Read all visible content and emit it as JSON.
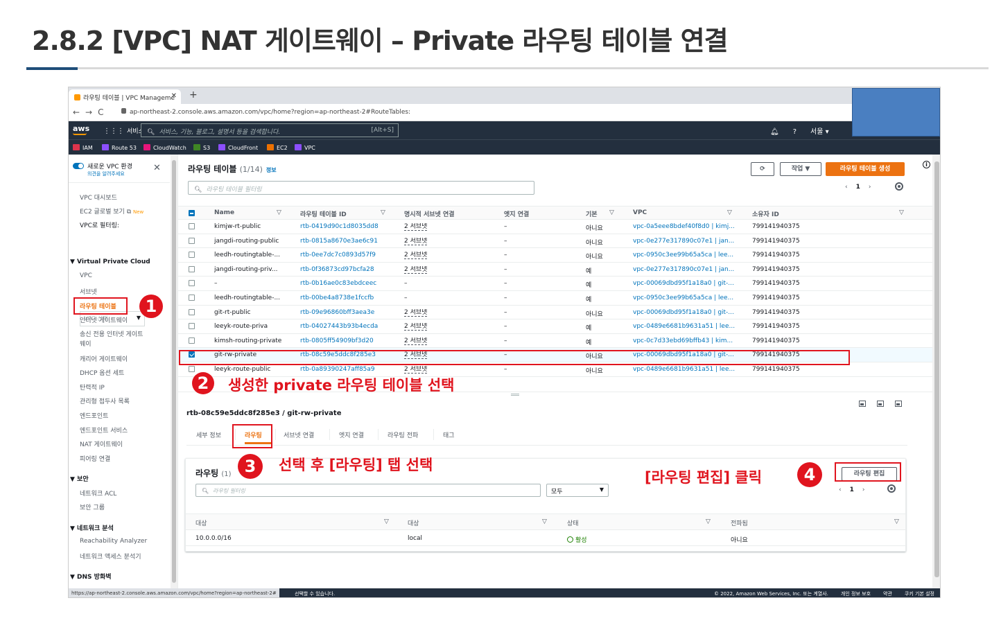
{
  "slide": {
    "title": "2.8.2 [VPC] NAT 게이트웨이 – Private 라우팅 테이블 연결"
  },
  "browser": {
    "tab_title": "라우팅 테이블 | VPC Manageme",
    "new_tab": "+",
    "url": "ap-northeast-2.console.aws.amazon.com/vpc/home?region=ap-northeast-2#RouteTables:"
  },
  "aws_nav": {
    "logo": "aws",
    "services": "서비스",
    "search_placeholder": "서비스, 기능, 블로그, 설명서 등을 검색합니다.",
    "search_hotkey": "[Alt+S]",
    "region": "서울 ▾",
    "bookmarks": [
      "IAM",
      "Route 53",
      "CloudWatch",
      "S3",
      "CloudFront",
      "EC2",
      "VPC"
    ]
  },
  "sidebar": {
    "new_vpc": "새로운 VPC 환경",
    "feedback": "의견을 알려주세요",
    "dashboard": "VPC 대시보드",
    "ec2_global": "EC2 글로벌 보기",
    "new_badge": "New",
    "filter_label": "VPC로 필터링:",
    "filter_placeholder": "VPC 선택",
    "section_vpc": "▼ Virtual Private Cloud",
    "items": [
      "VPC",
      "서브넷",
      "라우팅 테이블",
      "인터넷 게이트웨이",
      "송신 전용 인터넷 게이트",
      "웨이",
      "캐리어 게이트웨이",
      "DHCP 옵션 세트",
      "탄력적 IP",
      "관리형 접두사 목록",
      "엔드포인트",
      "엔드포인트 서비스",
      "NAT 게이트웨이",
      "피어링 연결"
    ],
    "section_security": "▼ 보안",
    "security_items": [
      "네트워크 ACL",
      "보안 그룹"
    ],
    "section_netanalysis": "▼ 네트워크 분석",
    "netanalysis_items": [
      "Reachability Analyzer",
      "네트워크 액세스 분석기"
    ],
    "section_dns": "▼ DNS 방화벽"
  },
  "main": {
    "title": "라우팅 테이블",
    "count": "(1/14)",
    "info": "정보",
    "actions": "작업 ▼",
    "create": "라우팅 테이블 생성",
    "filter_placeholder": "라우팅 테이블 필터링",
    "page": "1",
    "columns": [
      "Name",
      "라우팅 테이블 ID",
      "명시적 서브넷 연결",
      "엣지 연결",
      "기본",
      "VPC",
      "소유자 ID"
    ],
    "rows": [
      {
        "name": "kimjw-rt-public",
        "id": "rtb-0419d90c1d8035dd8",
        "subnet": "2 서브넷",
        "edge": "–",
        "main": "아니요",
        "vpc": "vpc-0a5eee8bdef40f8d0 | kimj...",
        "owner": "799141940375"
      },
      {
        "name": "jangdi-routing-public",
        "id": "rtb-0815a8670e3ae6c91",
        "subnet": "2 서브넷",
        "edge": "–",
        "main": "아니요",
        "vpc": "vpc-0e277e317890c07e1 | jan...",
        "owner": "799141940375"
      },
      {
        "name": "leedh-routingtable-...",
        "id": "rtb-0ee7dc7c0893d57f9",
        "subnet": "2 서브넷",
        "edge": "–",
        "main": "아니요",
        "vpc": "vpc-0950c3ee99b65a5ca | lee...",
        "owner": "799141940375"
      },
      {
        "name": "jangdi-routing-priv...",
        "id": "rtb-0f36873cd97bcfa28",
        "subnet": "2 서브넷",
        "edge": "–",
        "main": "예",
        "vpc": "vpc-0e277e317890c07e1 | jan...",
        "owner": "799141940375"
      },
      {
        "name": "–",
        "id": "rtb-0b16ae0c83ebdceec",
        "subnet": "–",
        "edge": "–",
        "main": "예",
        "vpc": "vpc-00069dbd95f1a18a0 | git-...",
        "owner": "799141940375"
      },
      {
        "name": "leedh-routingtable-...",
        "id": "rtb-00be4a8738e1fccfb",
        "subnet": "–",
        "edge": "–",
        "main": "예",
        "vpc": "vpc-0950c3ee99b65a5ca | lee...",
        "owner": "799141940375"
      },
      {
        "name": "git-rt-public",
        "id": "rtb-09e96860bff3aea3e",
        "subnet": "2 서브넷",
        "edge": "–",
        "main": "아니요",
        "vpc": "vpc-00069dbd95f1a18a0 | git-...",
        "owner": "799141940375"
      },
      {
        "name": "leeyk-route-priva",
        "id": "rtb-04027443b93b4ecda",
        "subnet": "2 서브넷",
        "edge": "–",
        "main": "예",
        "vpc": "vpc-0489e6681b9631a51 | lee...",
        "owner": "799141940375"
      },
      {
        "name": "kimsh-routing-private",
        "id": "rtb-0805ff54909bf3d20",
        "subnet": "2 서브넷",
        "edge": "–",
        "main": "예",
        "vpc": "vpc-0c7d33ebd69bffb43 | kim...",
        "owner": "799141940375"
      },
      {
        "name": "git-rw-private",
        "id": "rtb-08c59e5ddc8f285e3",
        "subnet": "2 서브넷",
        "edge": "–",
        "main": "아니요",
        "vpc": "vpc-00069dbd95f1a18a0 | git-...",
        "owner": "799141940375"
      },
      {
        "name": "leeyk-route-public",
        "id": "rtb-0a89390247aff85a9",
        "subnet": "2 서브넷",
        "edge": "–",
        "main": "아니요",
        "vpc": "vpc-0489e6681b9631a51 | lee...",
        "owner": "799141940375"
      }
    ]
  },
  "detail": {
    "title": "rtb-08c59e5ddc8f285e3 / git-rw-private",
    "tabs": [
      "세부 정보",
      "라우팅",
      "서브넷 연결",
      "엣지 연결",
      "라우팅 전파",
      "태그"
    ],
    "routes_title": "라우팅",
    "routes_count": "(1)",
    "edit_button": "라우팅 편집",
    "filter_placeholder": "라우팅 필터링",
    "filter_select": "모두",
    "page": "1",
    "columns": [
      "대상",
      "대상",
      "상태",
      "전파됨"
    ],
    "route_rows": [
      {
        "dest": "10.0.0.0/16",
        "target": "local",
        "status": "활성",
        "propagated": "아니요"
      }
    ]
  },
  "statusbar": {
    "url": "https://ap-northeast-2.console.aws.amazon.com/vpc/home?region=ap-northeast-2#",
    "msg": "선택할 수 있습니다.",
    "copyright": "© 2022, Amazon Web Services, Inc. 또는 계열사.",
    "privacy": "개인 정보 보호",
    "terms": "약관",
    "cookies": "쿠키 기본 설정"
  },
  "annotations": {
    "step1": "1",
    "step2": "2",
    "step2_text": "생성한 private 라우팅 테이블 선택",
    "step3": "3",
    "step3_text": "선택 후 [라우팅] 탭 선택",
    "step4": "4",
    "step4_text": "[라우팅 편집] 클릭"
  },
  "colors": {
    "aws_nav": "#232f3e",
    "accent_orange": "#ec7211",
    "link_blue": "#0073bb",
    "annotation_red": "#e0141e",
    "title_rule_blue": "#1f4e79"
  }
}
